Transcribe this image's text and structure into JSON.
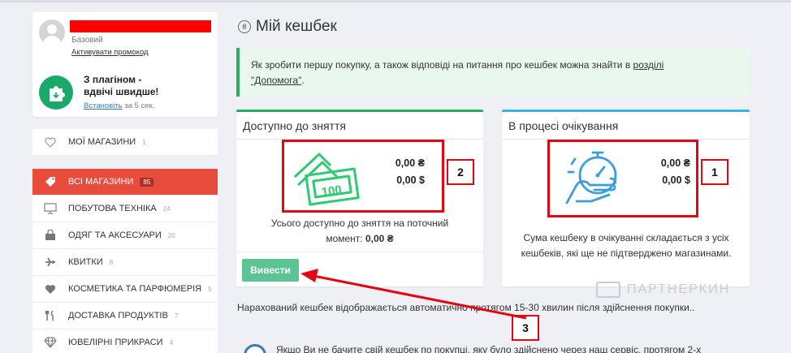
{
  "user": {
    "plan": "Базовий",
    "promo_link": "Активувати промокод"
  },
  "plugin": {
    "line1": "З плагіном -",
    "line2": "вдвічі швидше!",
    "install_link": "Встановіть",
    "time_text": "за 5 сек."
  },
  "menu": {
    "my_stores": {
      "label": "МОЇ МАГАЗИНИ",
      "count": "1"
    },
    "items": [
      {
        "label": "ВСІ МАГАЗИНИ",
        "count": "85"
      },
      {
        "label": "ПОБУТОВА ТЕХНІКА",
        "count": "24"
      },
      {
        "label": "ОДЯГ ТА АКСЕСУАРИ",
        "count": "20"
      },
      {
        "label": "КВИТКИ",
        "count": "8"
      },
      {
        "label": "КОСМЕТИКА ТА ПАРФЮМЕРІЯ",
        "count": "5"
      },
      {
        "label": "ДОСТАВКА ПРОДУКТІВ",
        "count": "7"
      },
      {
        "label": "ЮВЕЛІРНІ ПРИКРАСИ",
        "count": "4"
      }
    ]
  },
  "page": {
    "title": "Мій кешбек"
  },
  "alert": {
    "text": "Як зробити першу покупку, а також відповіді на питання про кешбек можна знайти в ",
    "link_part1": "розділі",
    "link_part2": "\"Допомога\"",
    "suffix": "."
  },
  "available": {
    "title": "Доступно до зняття",
    "uah": "0,00 ₴",
    "usd": "0,00 $",
    "note_line1": "Усього доступно до зняття на поточний",
    "note_line2_prefix": "момент: ",
    "note_amount": "0,00 ₴",
    "button": "Вивести",
    "bill_value": "100"
  },
  "pending": {
    "title": "В процесі очікування",
    "uah": "0,00 ₴",
    "usd": "0,00 $",
    "note_line1": "Сума кешбеку в очікуванні складається з усіх",
    "note_line2": "кешбеків, які ще не підтверджено магазинами."
  },
  "callouts": {
    "one": "1",
    "two": "2",
    "three": "3"
  },
  "info": {
    "line": "Нарахований кешбек відображається автоматично протягом 15-30 хвилин після здійснення покупки..",
    "bottom": "Якщо Ви не бачите свій кешбек по покупці, яку було здійснено через наш сервіс, протягом 2-х"
  },
  "watermark": "ПАРТНЕРКИН",
  "colors": {
    "accent_red": "#e84c3d",
    "green": "#27ae60",
    "blue": "#3bb3e0",
    "button_green": "#5cc492",
    "annotation_red": "#e30613"
  }
}
